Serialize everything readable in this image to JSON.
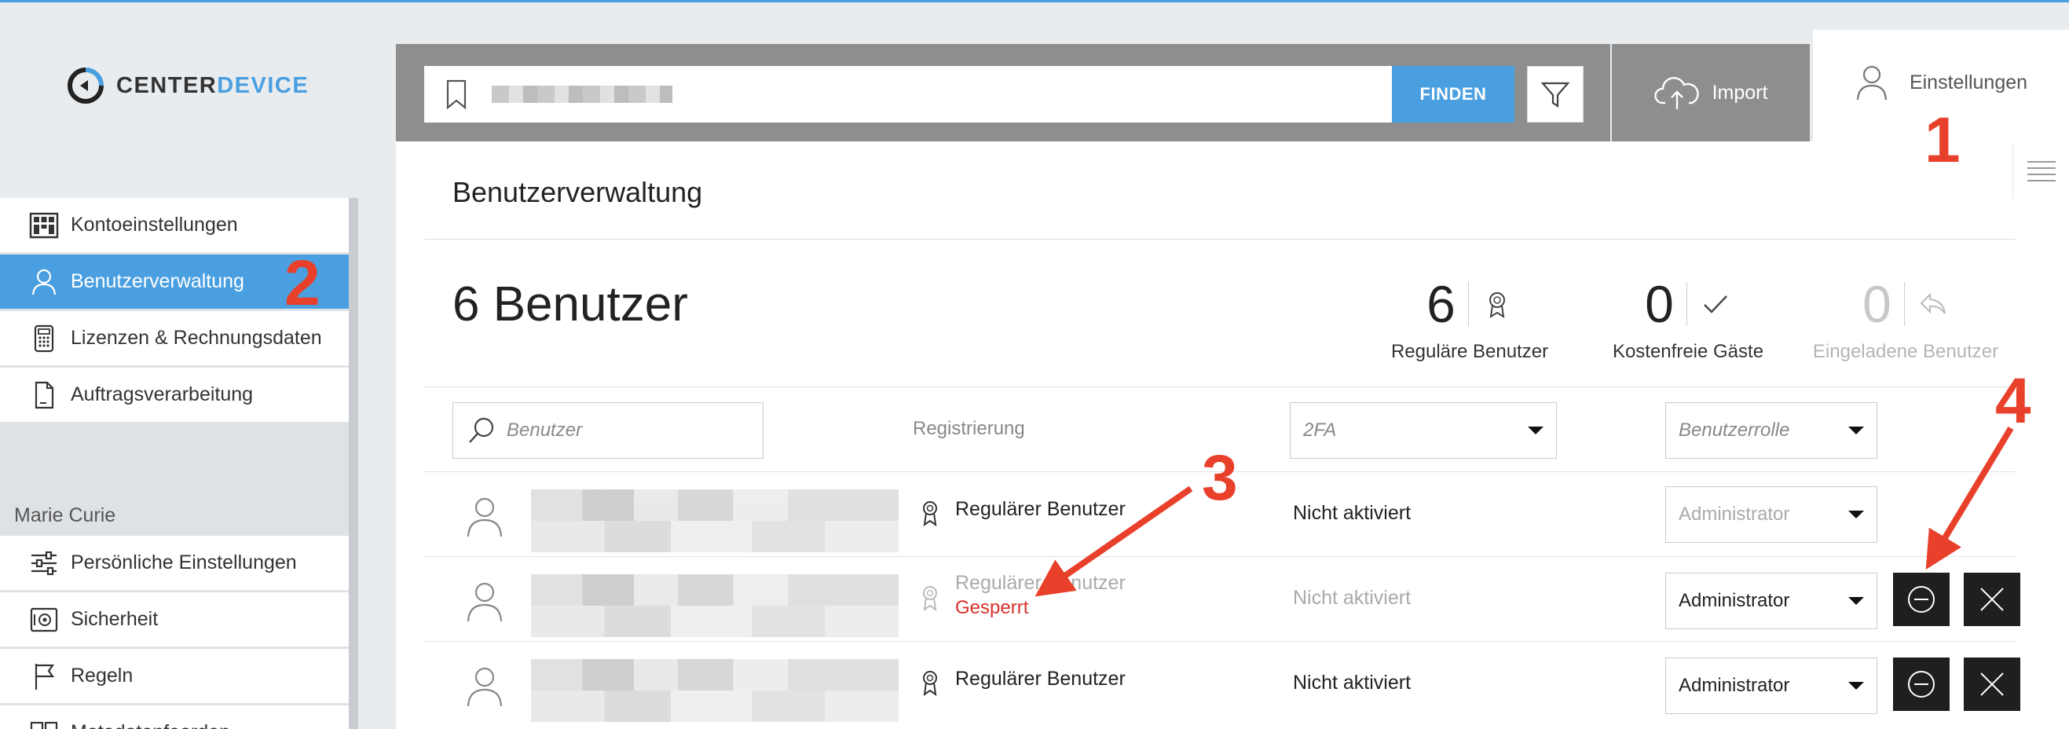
{
  "brand": {
    "name_part1": "CENTER",
    "name_part2": "DEVICE",
    "accent": "#4a9fe0"
  },
  "topbar": {
    "find_label": "FINDEN",
    "import_label": "Import",
    "settings_label": "Einstellungen"
  },
  "sidebar": {
    "items": [
      {
        "label": "Kontoeinstellungen",
        "icon": "grid-icon"
      },
      {
        "label": "Benutzerverwaltung",
        "icon": "user-icon"
      },
      {
        "label": "Lizenzen & Rechnungsdaten",
        "icon": "calculator-icon"
      },
      {
        "label": "Auftragsverarbeitung",
        "icon": "document-icon"
      }
    ],
    "user_name": "Marie Curie",
    "personal_items": [
      {
        "label": "Persönliche Einstellungen",
        "icon": "sliders-icon"
      },
      {
        "label": "Sicherheit",
        "icon": "safe-icon"
      },
      {
        "label": "Regeln",
        "icon": "flag-icon"
      },
      {
        "label": "Metadatenfeorden",
        "icon": "fields-icon"
      }
    ]
  },
  "main": {
    "title": "Benutzerverwaltung",
    "user_count": "6 Benutzer",
    "stats": [
      {
        "value": "6",
        "label": "Reguläre Benutzer",
        "icon": "award-icon"
      },
      {
        "value": "0",
        "label": "Kostenfreie Gäste",
        "icon": "check-icon"
      },
      {
        "value": "0",
        "label": "Eingeladene Benutzer",
        "icon": "reply-icon"
      }
    ],
    "filters": {
      "search_placeholder": "Benutzer",
      "registration_label": "Registrierung",
      "twofa_placeholder": "2FA",
      "role_placeholder": "Benutzerrolle"
    },
    "rows": [
      {
        "registration": "Regulärer Benutzer",
        "locked": "",
        "twofa": "Nicht aktiviert",
        "role": "Administrator",
        "role_disabled": true,
        "actions": false
      },
      {
        "registration": "Regulärer Benutzer",
        "locked": "Gesperrt",
        "twofa": "Nicht aktiviert",
        "role": "Administrator",
        "role_disabled": false,
        "actions": true
      },
      {
        "registration": "Regulärer Benutzer",
        "locked": "",
        "twofa": "Nicht aktiviert",
        "role": "Administrator",
        "role_disabled": false,
        "actions": true
      }
    ]
  },
  "annotations": {
    "n1": "1",
    "n2": "2",
    "n3": "3",
    "n4": "4",
    "color": "#e8402a"
  }
}
